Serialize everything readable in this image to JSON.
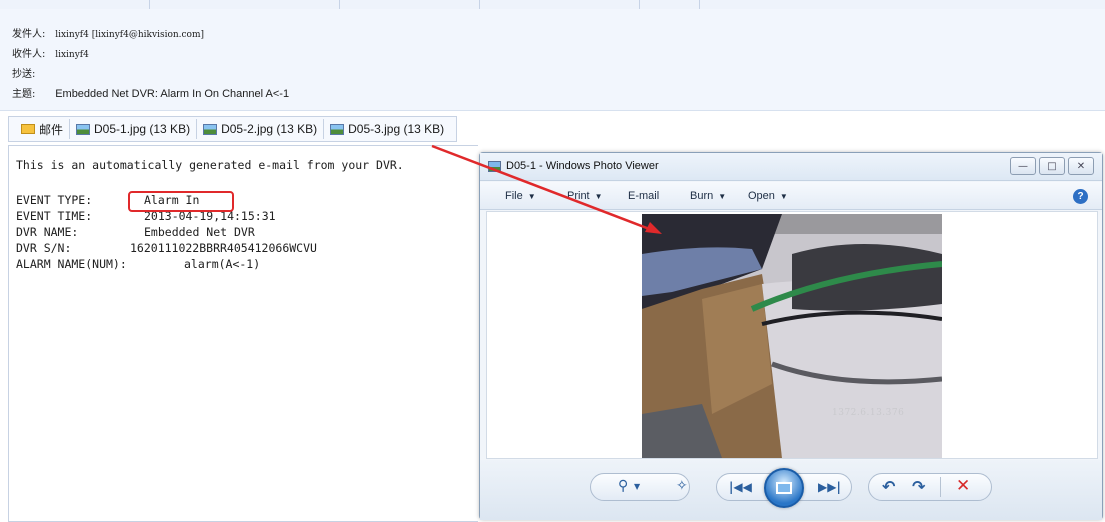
{
  "email": {
    "from_label": "发件人:",
    "from_value": "lixinyf4 [lixinyf4@hikvision.com]",
    "to_label": "收件人:",
    "to_value": "lixinyf4",
    "cc_label": "抄送:",
    "subject_label": "主题:",
    "subject_value": "Embedded Net DVR: Alarm In On Channel A<-1"
  },
  "attachments": {
    "mail_label": "邮件",
    "files": [
      "D05-1.jpg (13 KB)",
      "D05-2.jpg (13 KB)",
      "D05-3.jpg (13 KB)"
    ]
  },
  "body": {
    "intro": "This is an automatically generated e-mail from your DVR.",
    "lines": [
      {
        "label": "EVENT TYPE:",
        "value": "Alarm In"
      },
      {
        "label": "EVENT TIME:",
        "value": "2013-04-19,14:15:31"
      },
      {
        "label": "DVR NAME:",
        "value": "Embedded Net DVR"
      },
      {
        "label": "DVR S/N:",
        "value": "1620111022BBRR405412066WCVU"
      },
      {
        "label": "ALARM NAME(NUM):",
        "value": "alarm(A<-1)"
      }
    ]
  },
  "viewer": {
    "title": "D05-1 - Windows Photo Viewer",
    "menu": [
      "File",
      "Print",
      "E-mail",
      "Burn",
      "Open"
    ],
    "photo_stamp": "1372.6.13.376"
  },
  "colors": {
    "highlight_red": "#e0292b",
    "header_bg": "#f2f6fd",
    "accent_blue": "#2b5f9e"
  }
}
